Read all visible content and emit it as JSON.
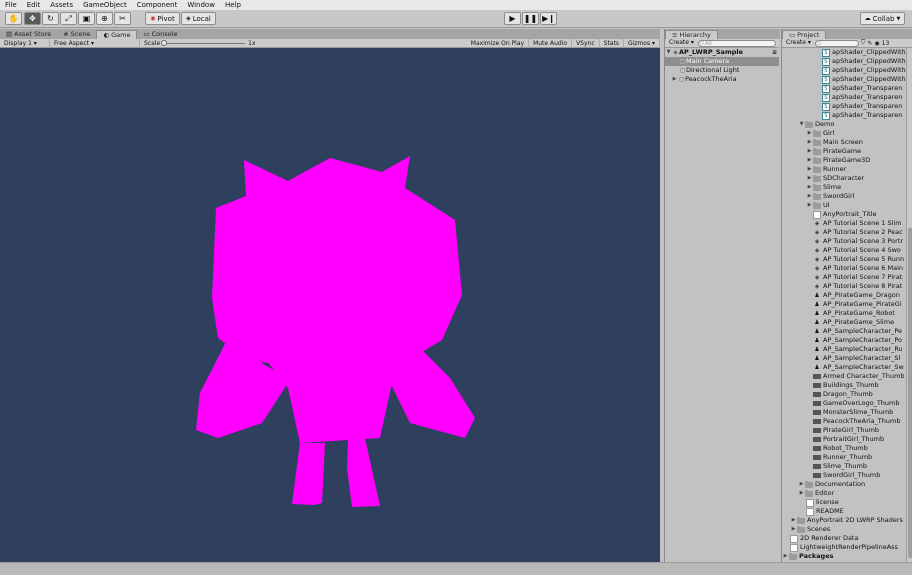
{
  "menu": [
    "File",
    "Edit",
    "Assets",
    "GameObject",
    "Component",
    "Window",
    "Help"
  ],
  "toolbar": {
    "pivot_label": "Pivot",
    "local_label": "Local",
    "collab_label": "Collab",
    "tools": [
      "hand-icon",
      "move-icon",
      "rotate-icon",
      "scale-icon",
      "rect-icon",
      "transform-icon",
      "custom-tool-icon"
    ]
  },
  "main_tabs": {
    "asset_store": "Asset Store",
    "scene": "Scene",
    "game": "Game",
    "console": "Console"
  },
  "game_toolbar": {
    "display": "Display 1",
    "aspect": "Free Aspect",
    "scale_label": "Scale",
    "scale_value": "1x",
    "maximize": "Maximize On Play",
    "mute": "Mute Audio",
    "vsync": "VSync",
    "stats": "Stats",
    "gizmos": "Gizmos"
  },
  "colors": {
    "game_bg": "#2f3f5e",
    "character": "#ff00ff"
  },
  "hierarchy": {
    "tab": "Hierarchy",
    "create": "Create",
    "search_placeholder": "All",
    "scene_name": "AP_LWRP_Sample",
    "items": [
      "Main Camera",
      "Directional Light",
      "PeacockTheAria"
    ]
  },
  "project": {
    "tab": "Project",
    "create": "Create",
    "count": "13",
    "top_scripts": [
      "apShader_ClippedWith",
      "apShader_ClippedWith",
      "apShader_ClippedWith",
      "apShader_ClippedWith",
      "apShader_Transparen",
      "apShader_Transparen",
      "apShader_Transparen",
      "apShader_Transparen"
    ],
    "demo_folder": "Demo",
    "demo_subfolders": [
      "Girl",
      "Main Screen",
      "PirateGame",
      "PirateGame3D",
      "Runner",
      "SDCharacter",
      "Slime",
      "SwordGirl",
      "UI"
    ],
    "demo_title": "AnyPortrait_Title",
    "demo_scenes": [
      "AP Tutorial Scene 1 Slim",
      "AP Tutorial Scene 2 Peac",
      "AP Tutorial Scene 3 Portr",
      "AP Tutorial Scene 4 Swo",
      "AP Tutorial Scene 5 Runn",
      "AP Tutorial Scene 6 Main",
      "AP Tutorial Scene 7 Pirat",
      "AP Tutorial Scene 8 Pirat"
    ],
    "demo_prefabs": [
      "AP_PirateGame_Dragon",
      "AP_PirateGame_PirateGi",
      "AP_PirateGame_Robot",
      "AP_PirateGame_Slime",
      "AP_SampleCharacter_Pe",
      "AP_SampleCharacter_Po",
      "AP_SampleCharacter_Ru",
      "AP_SampleCharacter_Sl",
      "AP_SampleCharacter_Sw"
    ],
    "demo_thumbs": [
      "Armed Character_Thumb",
      "Buildings_Thumb",
      "Dragon_Thumb",
      "GameOverLogo_Thumb",
      "MonsterSlime_Thumb",
      "PeacockTheAria_Thumb",
      "PirateGirl_Thumb",
      "PortraitGirl_Thumb",
      "Robot_Thumb",
      "Runner_Thumb",
      "Slime_Thumb",
      "SwordGirl_Thumb"
    ],
    "bottom_folders": [
      "Documentation",
      "Editor"
    ],
    "bottom_files": [
      "license",
      "README"
    ],
    "root_items": [
      "AnyPortrait 2D LWRP Shaders",
      "Scenes",
      "2D Renderer Data",
      "LightweightRenderPipelineAss"
    ],
    "packages": "Packages"
  }
}
